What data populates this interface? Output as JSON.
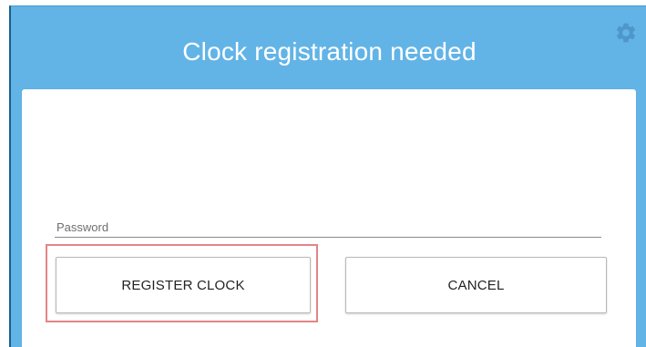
{
  "header": {
    "title": "Clock registration needed",
    "settings_icon": "gear-icon",
    "background_color": "#62b4e7"
  },
  "form": {
    "password_label": "Password",
    "password_value": ""
  },
  "buttons": {
    "register_label": "REGISTER CLOCK",
    "cancel_label": "CANCEL"
  },
  "highlight_color": "#e38486"
}
